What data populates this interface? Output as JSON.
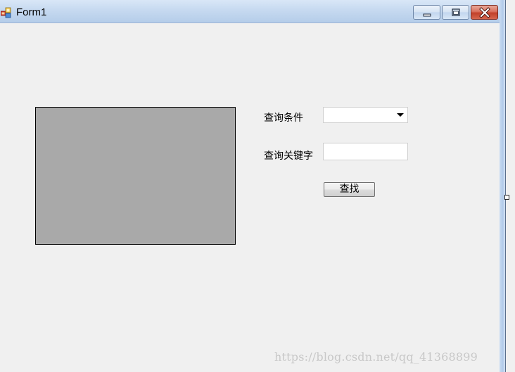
{
  "window": {
    "title": "Form1"
  },
  "form": {
    "condition_label": "查询条件",
    "condition_value": "",
    "keyword_label": "查询关键字",
    "keyword_value": "",
    "search_button_label": "查找"
  },
  "watermark": {
    "text": "https://blog.csdn.net/qq_41368899"
  },
  "colors": {
    "picture_box_fill": "#a9a9a9",
    "client_background": "#f0f0f0",
    "close_button": "#c2402a"
  },
  "icons": {
    "app": "winforms-app-icon",
    "minimize": "minimize-icon",
    "maximize": "maximize-icon",
    "close": "close-icon",
    "dropdown": "chevron-down-icon"
  }
}
